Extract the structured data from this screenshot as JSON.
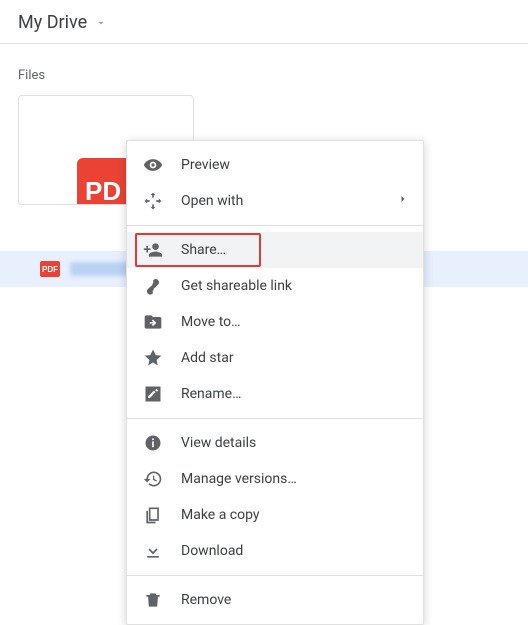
{
  "header": {
    "title": "My Drive"
  },
  "section": {
    "label": "Files"
  },
  "thumb": {
    "badge": "PD"
  },
  "selected": {
    "badge": "PDF"
  },
  "menu": {
    "preview": "Preview",
    "open_with": "Open with",
    "share": "Share…",
    "get_link": "Get shareable link",
    "move_to": "Move to…",
    "add_star": "Add star",
    "rename": "Rename…",
    "view_details": "View details",
    "manage_versions": "Manage versions…",
    "make_copy": "Make a copy",
    "download": "Download",
    "remove": "Remove"
  }
}
